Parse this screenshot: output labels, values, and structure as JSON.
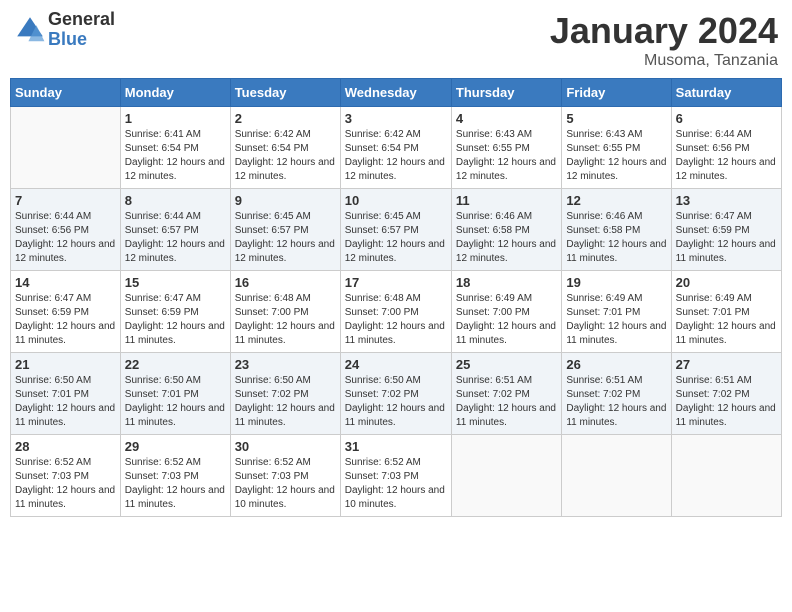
{
  "header": {
    "logo_general": "General",
    "logo_blue": "Blue",
    "month_title": "January 2024",
    "location": "Musoma, Tanzania"
  },
  "weekdays": [
    "Sunday",
    "Monday",
    "Tuesday",
    "Wednesday",
    "Thursday",
    "Friday",
    "Saturday"
  ],
  "weeks": [
    [
      {
        "day": "",
        "info": ""
      },
      {
        "day": "1",
        "info": "Sunrise: 6:41 AM\nSunset: 6:54 PM\nDaylight: 12 hours and 12 minutes."
      },
      {
        "day": "2",
        "info": "Sunrise: 6:42 AM\nSunset: 6:54 PM\nDaylight: 12 hours and 12 minutes."
      },
      {
        "day": "3",
        "info": "Sunrise: 6:42 AM\nSunset: 6:54 PM\nDaylight: 12 hours and 12 minutes."
      },
      {
        "day": "4",
        "info": "Sunrise: 6:43 AM\nSunset: 6:55 PM\nDaylight: 12 hours and 12 minutes."
      },
      {
        "day": "5",
        "info": "Sunrise: 6:43 AM\nSunset: 6:55 PM\nDaylight: 12 hours and 12 minutes."
      },
      {
        "day": "6",
        "info": "Sunrise: 6:44 AM\nSunset: 6:56 PM\nDaylight: 12 hours and 12 minutes."
      }
    ],
    [
      {
        "day": "7",
        "info": "Sunrise: 6:44 AM\nSunset: 6:56 PM\nDaylight: 12 hours and 12 minutes."
      },
      {
        "day": "8",
        "info": "Sunrise: 6:44 AM\nSunset: 6:57 PM\nDaylight: 12 hours and 12 minutes."
      },
      {
        "day": "9",
        "info": "Sunrise: 6:45 AM\nSunset: 6:57 PM\nDaylight: 12 hours and 12 minutes."
      },
      {
        "day": "10",
        "info": "Sunrise: 6:45 AM\nSunset: 6:57 PM\nDaylight: 12 hours and 12 minutes."
      },
      {
        "day": "11",
        "info": "Sunrise: 6:46 AM\nSunset: 6:58 PM\nDaylight: 12 hours and 12 minutes."
      },
      {
        "day": "12",
        "info": "Sunrise: 6:46 AM\nSunset: 6:58 PM\nDaylight: 12 hours and 11 minutes."
      },
      {
        "day": "13",
        "info": "Sunrise: 6:47 AM\nSunset: 6:59 PM\nDaylight: 12 hours and 11 minutes."
      }
    ],
    [
      {
        "day": "14",
        "info": "Sunrise: 6:47 AM\nSunset: 6:59 PM\nDaylight: 12 hours and 11 minutes."
      },
      {
        "day": "15",
        "info": "Sunrise: 6:47 AM\nSunset: 6:59 PM\nDaylight: 12 hours and 11 minutes."
      },
      {
        "day": "16",
        "info": "Sunrise: 6:48 AM\nSunset: 7:00 PM\nDaylight: 12 hours and 11 minutes."
      },
      {
        "day": "17",
        "info": "Sunrise: 6:48 AM\nSunset: 7:00 PM\nDaylight: 12 hours and 11 minutes."
      },
      {
        "day": "18",
        "info": "Sunrise: 6:49 AM\nSunset: 7:00 PM\nDaylight: 12 hours and 11 minutes."
      },
      {
        "day": "19",
        "info": "Sunrise: 6:49 AM\nSunset: 7:01 PM\nDaylight: 12 hours and 11 minutes."
      },
      {
        "day": "20",
        "info": "Sunrise: 6:49 AM\nSunset: 7:01 PM\nDaylight: 12 hours and 11 minutes."
      }
    ],
    [
      {
        "day": "21",
        "info": "Sunrise: 6:50 AM\nSunset: 7:01 PM\nDaylight: 12 hours and 11 minutes."
      },
      {
        "day": "22",
        "info": "Sunrise: 6:50 AM\nSunset: 7:01 PM\nDaylight: 12 hours and 11 minutes."
      },
      {
        "day": "23",
        "info": "Sunrise: 6:50 AM\nSunset: 7:02 PM\nDaylight: 12 hours and 11 minutes."
      },
      {
        "day": "24",
        "info": "Sunrise: 6:50 AM\nSunset: 7:02 PM\nDaylight: 12 hours and 11 minutes."
      },
      {
        "day": "25",
        "info": "Sunrise: 6:51 AM\nSunset: 7:02 PM\nDaylight: 12 hours and 11 minutes."
      },
      {
        "day": "26",
        "info": "Sunrise: 6:51 AM\nSunset: 7:02 PM\nDaylight: 12 hours and 11 minutes."
      },
      {
        "day": "27",
        "info": "Sunrise: 6:51 AM\nSunset: 7:02 PM\nDaylight: 12 hours and 11 minutes."
      }
    ],
    [
      {
        "day": "28",
        "info": "Sunrise: 6:52 AM\nSunset: 7:03 PM\nDaylight: 12 hours and 11 minutes."
      },
      {
        "day": "29",
        "info": "Sunrise: 6:52 AM\nSunset: 7:03 PM\nDaylight: 12 hours and 11 minutes."
      },
      {
        "day": "30",
        "info": "Sunrise: 6:52 AM\nSunset: 7:03 PM\nDaylight: 12 hours and 10 minutes."
      },
      {
        "day": "31",
        "info": "Sunrise: 6:52 AM\nSunset: 7:03 PM\nDaylight: 12 hours and 10 minutes."
      },
      {
        "day": "",
        "info": ""
      },
      {
        "day": "",
        "info": ""
      },
      {
        "day": "",
        "info": ""
      }
    ]
  ]
}
